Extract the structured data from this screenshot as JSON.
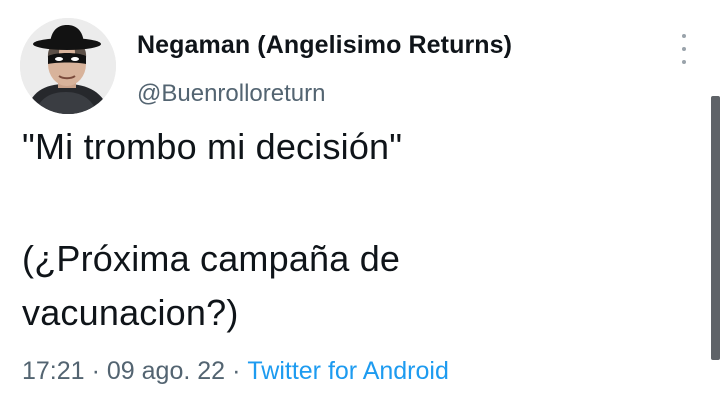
{
  "tweet": {
    "author": {
      "display_name": "Negaman (Angelisimo Returns)",
      "handle": "@Buenrolloreturn",
      "avatar_icon": "avatar-masked-man"
    },
    "menu_icon": "more-vertical-icon",
    "text_lines": [
      "\"Mi trombo mi decisión\"",
      "(¿Próxima campaña de",
      "vacunacion?)"
    ],
    "time": "17:21",
    "date": "09 ago. 22",
    "separator": "·",
    "source": "Twitter for Android"
  },
  "colors": {
    "text_primary": "#0f1419",
    "text_secondary": "#536471",
    "link": "#1d9bf0",
    "scrollbar": "#5f6368"
  }
}
